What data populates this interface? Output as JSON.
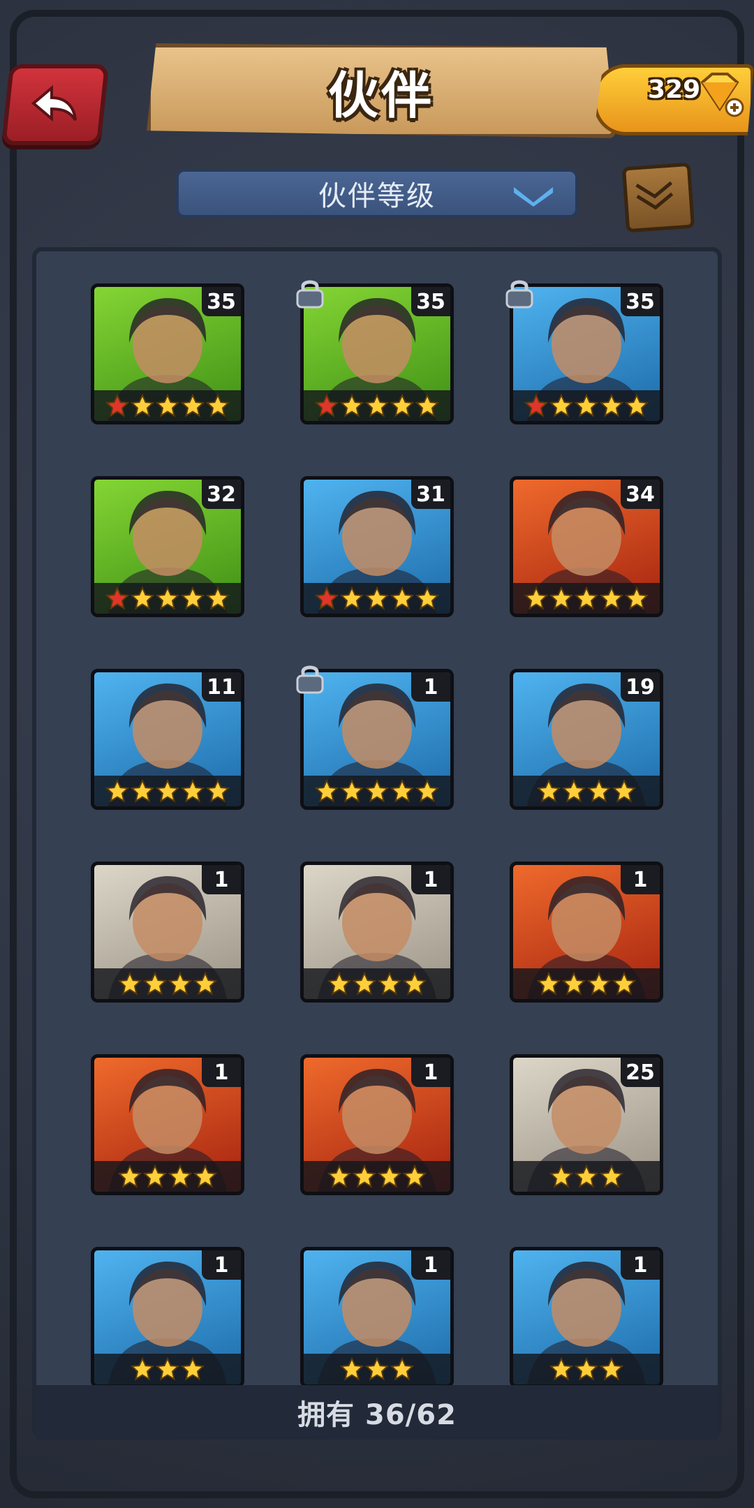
{
  "header": {
    "title": "伙伴",
    "gems": "329"
  },
  "sort": {
    "label": "伙伴等级"
  },
  "colors": {
    "green_bg": "#5fb82a",
    "blue_bg": "#2a8fd4",
    "red_bg": "#d8401e",
    "gray_bg": "#b9b3a6",
    "gold_star": "#ffcf3a",
    "red_star": "#e0352a"
  },
  "companions": [
    {
      "name_icon": "long-hair-rogue-portrait",
      "level": "35",
      "stars": 5,
      "red_stars": 1,
      "bg": "green",
      "locked": false
    },
    {
      "name_icon": "dark-hair-woman-portrait",
      "level": "35",
      "stars": 5,
      "red_stars": 1,
      "bg": "green",
      "locked": true
    },
    {
      "name_icon": "mohawk-viking-portrait",
      "level": "35",
      "stars": 5,
      "red_stars": 1,
      "bg": "blue",
      "locked": true
    },
    {
      "name_icon": "crocodile-portrait",
      "level": "32",
      "stars": 5,
      "red_stars": 1,
      "bg": "green",
      "locked": false
    },
    {
      "name_icon": "blue-hair-warrior-portrait",
      "level": "31",
      "stars": 5,
      "red_stars": 1,
      "bg": "blue",
      "locked": false
    },
    {
      "name_icon": "afro-bandana-woman-portrait",
      "level": "34",
      "stars": 5,
      "red_stars": 0,
      "bg": "red",
      "locked": false
    },
    {
      "name_icon": "hooded-mage-portrait",
      "level": "11",
      "stars": 5,
      "red_stars": 0,
      "bg": "blue",
      "locked": false
    },
    {
      "name_icon": "bearded-barbarian-portrait",
      "level": "1",
      "stars": 5,
      "red_stars": 0,
      "bg": "blue",
      "locked": true
    },
    {
      "name_icon": "boar-warrior-portrait",
      "level": "19",
      "stars": 4,
      "red_stars": 0,
      "bg": "blue",
      "locked": false
    },
    {
      "name_icon": "purple-walrus-portrait",
      "level": "1",
      "stars": 4,
      "red_stars": 0,
      "bg": "gray",
      "locked": false
    },
    {
      "name_icon": "purple-walrus-portrait",
      "level": "1",
      "stars": 4,
      "red_stars": 0,
      "bg": "gray",
      "locked": false
    },
    {
      "name_icon": "fish-monster-portrait",
      "level": "1",
      "stars": 4,
      "red_stars": 0,
      "bg": "red",
      "locked": false
    },
    {
      "name_icon": "red-hat-beast-portrait",
      "level": "1",
      "stars": 4,
      "red_stars": 0,
      "bg": "red",
      "locked": false
    },
    {
      "name_icon": "red-hair-girl-portrait",
      "level": "1",
      "stars": 4,
      "red_stars": 0,
      "bg": "red",
      "locked": false
    },
    {
      "name_icon": "purple-walrus-portrait",
      "level": "25",
      "stars": 3,
      "red_stars": 0,
      "bg": "gray",
      "locked": false
    },
    {
      "name_icon": "blue-werewolf-portrait",
      "level": "1",
      "stars": 3,
      "red_stars": 0,
      "bg": "blue",
      "locked": false
    },
    {
      "name_icon": "blue-hair-warrior-portrait",
      "level": "1",
      "stars": 3,
      "red_stars": 0,
      "bg": "blue",
      "locked": false
    },
    {
      "name_icon": "tattooed-brute-portrait",
      "level": "1",
      "stars": 3,
      "red_stars": 0,
      "bg": "blue",
      "locked": false
    }
  ],
  "footer": {
    "owned_label": "拥有 36/62"
  }
}
